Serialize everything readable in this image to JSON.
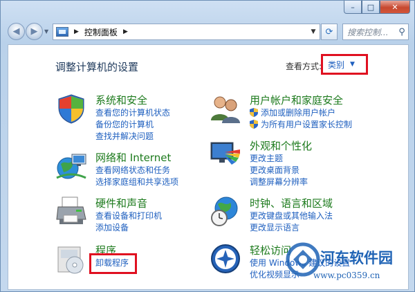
{
  "window": {
    "min_glyph": "–",
    "max_glyph": "□",
    "close_glyph": "✕"
  },
  "address": {
    "back_glyph": "◀",
    "forward_glyph": "▶",
    "breadcrumb": "控制面板",
    "search_placeholder": "搜索控制..."
  },
  "header": {
    "title": "调整计算机的设置",
    "view_by_label": "查看方式:",
    "view_by_value": "类别"
  },
  "categories": [
    {
      "title": "系统和安全",
      "links": [
        "查看您的计算机状态",
        "备份您的计算机",
        "查找并解决问题"
      ]
    },
    {
      "title": "网络和 Internet",
      "links": [
        "查看网络状态和任务",
        "选择家庭组和共享选项"
      ]
    },
    {
      "title": "硬件和声音",
      "links": [
        "查看设备和打印机",
        "添加设备"
      ]
    },
    {
      "title": "程序",
      "links": [
        "卸载程序"
      ]
    },
    {
      "title": "用户帐户和家庭安全",
      "links": [
        "添加或删除用户帐户",
        "为所有用户设置家长控制"
      ]
    },
    {
      "title": "外观和个性化",
      "links": [
        "更改主题",
        "更改桌面背景",
        "调整屏幕分辨率"
      ]
    },
    {
      "title": "时钟、语言和区域",
      "links": [
        "更改键盘或其他输入法",
        "更改显示语言"
      ]
    },
    {
      "title": "轻松访问",
      "links": [
        "使用 Windows 建议的设置",
        "优化视频显示"
      ]
    }
  ],
  "watermark": {
    "name": "河东软件园",
    "url": "www.pc0359.cn"
  },
  "colors": {
    "category_title": "#1c7a1c",
    "link": "#1e5fbf",
    "highlight": "#e01020",
    "page_title": "#1e395b"
  },
  "icons": [
    "shield-icon",
    "network-globe-icon",
    "printer-icon",
    "programs-icon",
    "users-icon",
    "monitor-palette-icon",
    "clock-globe-icon",
    "ease-of-access-icon"
  ]
}
